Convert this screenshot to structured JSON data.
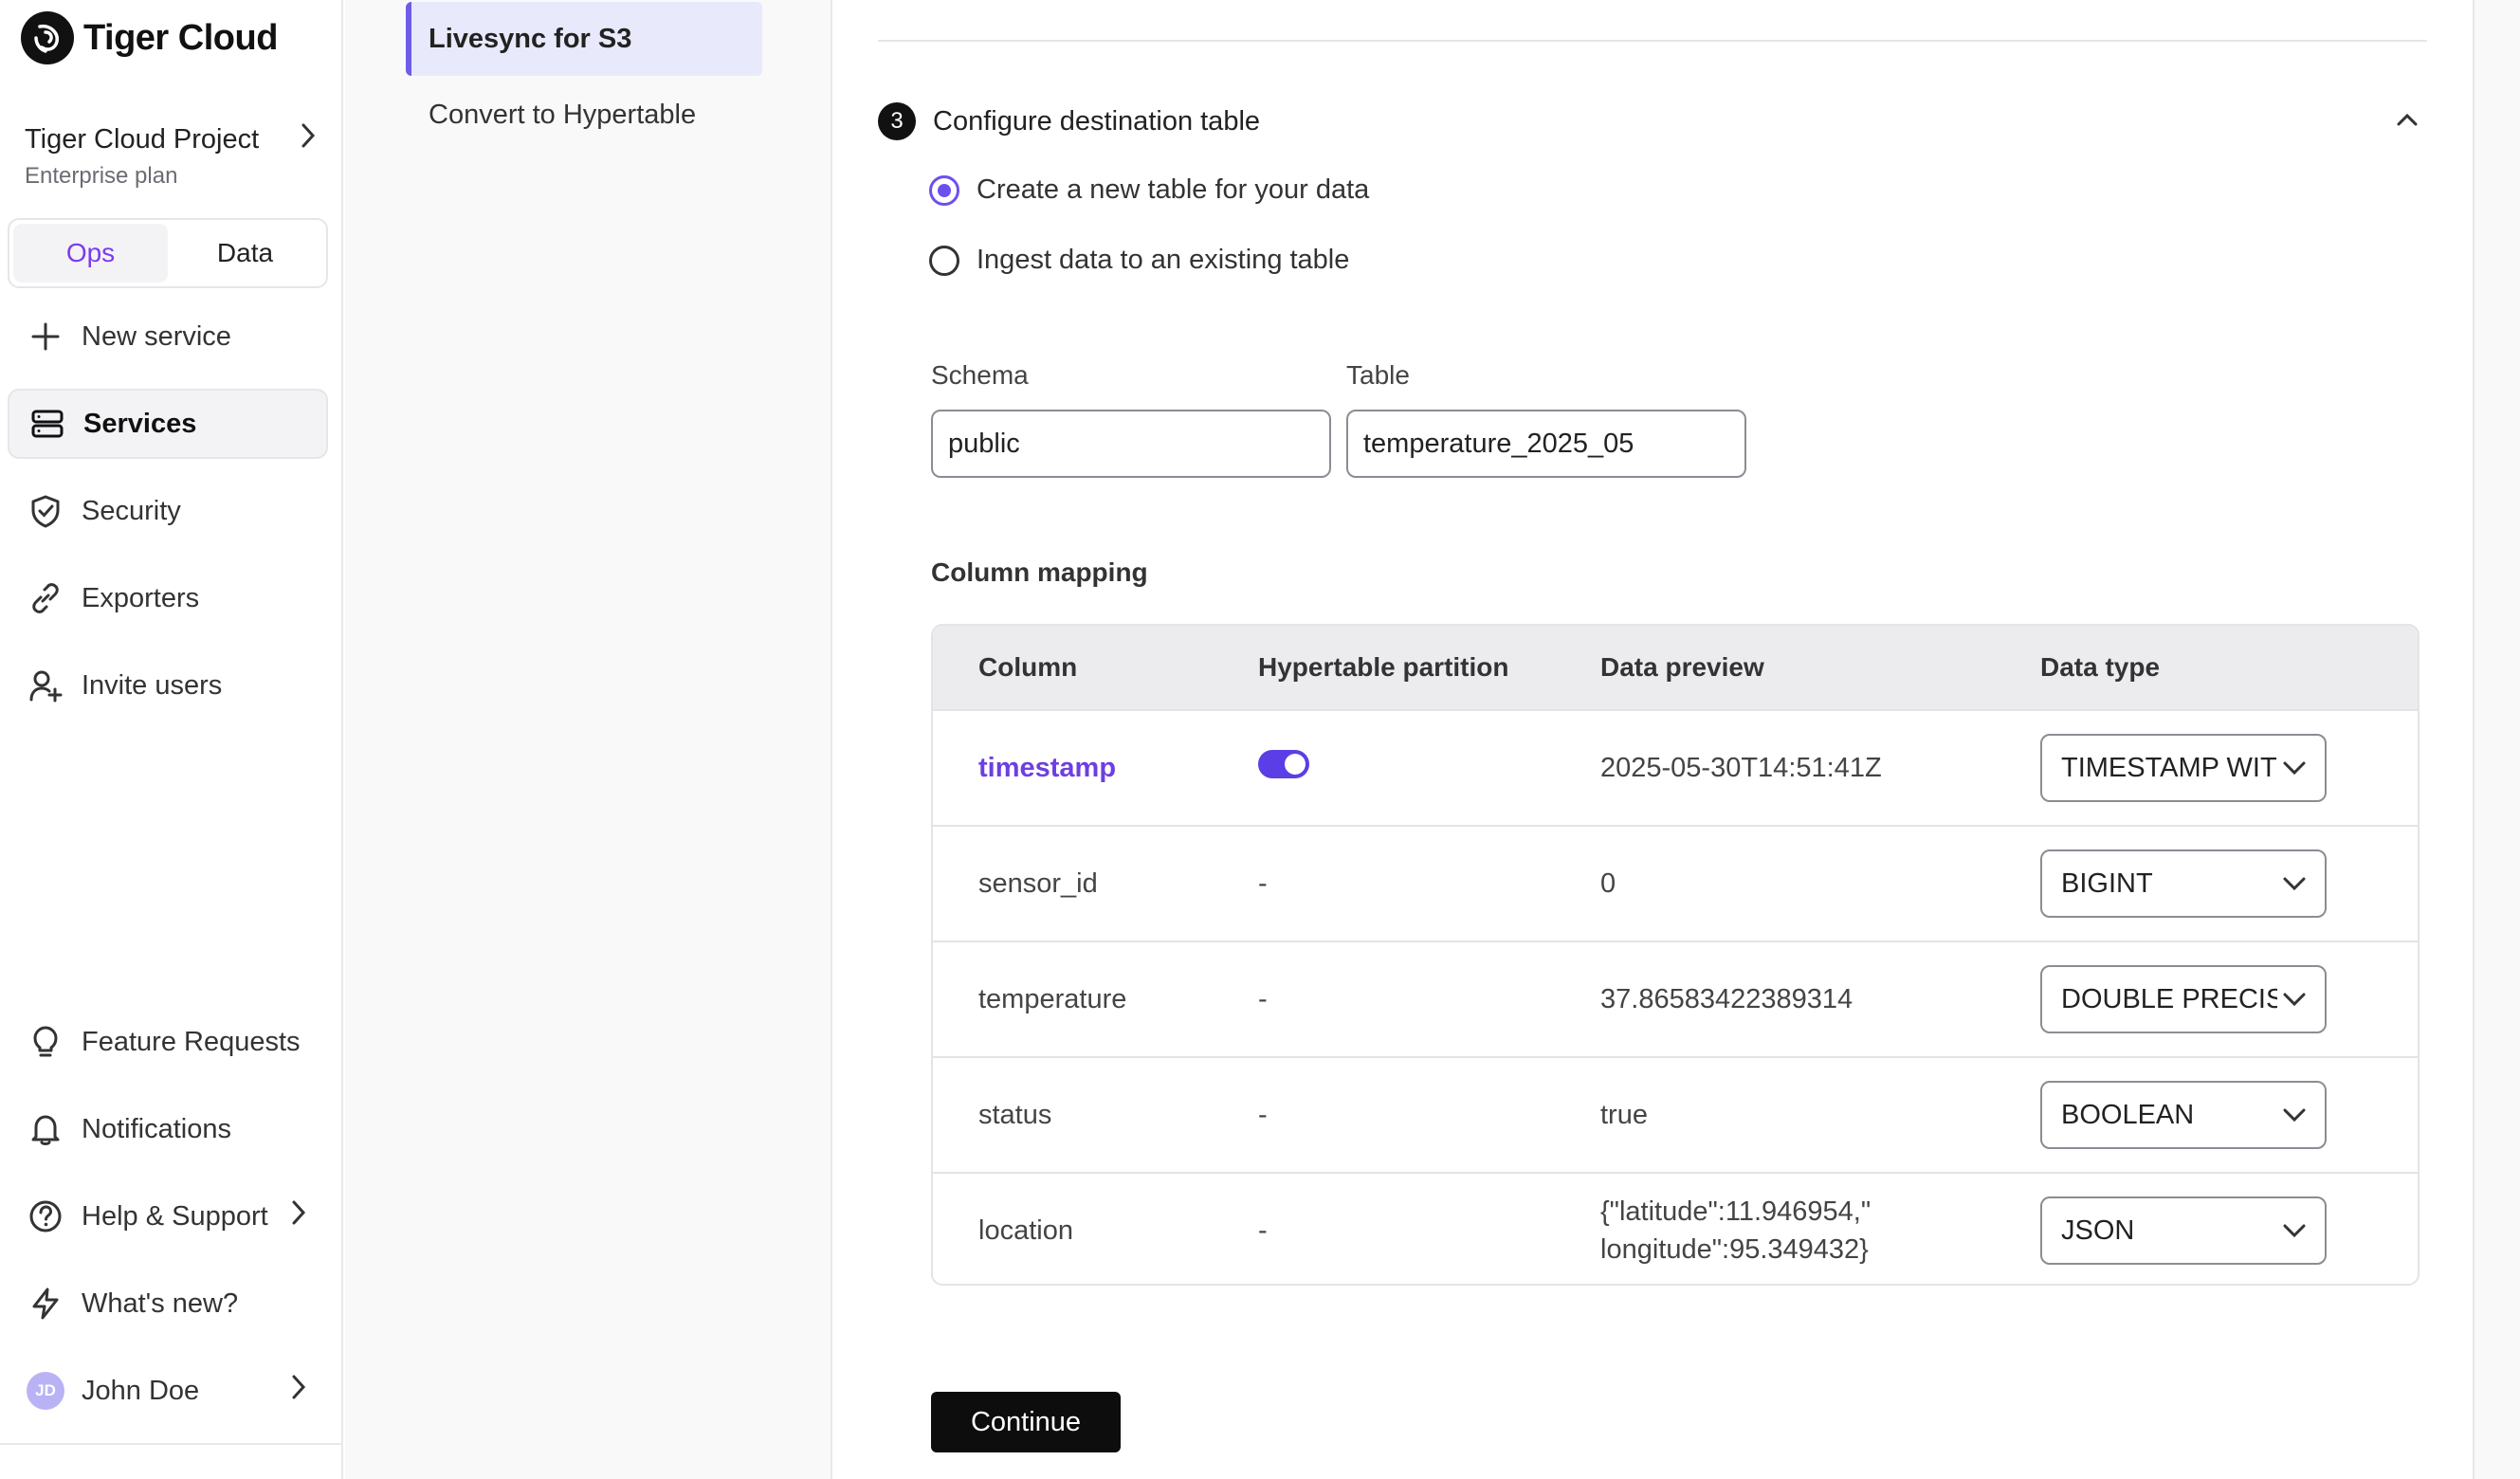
{
  "brand": {
    "name": "Tiger Cloud"
  },
  "project": {
    "name": "Tiger Cloud Project",
    "plan": "Enterprise plan"
  },
  "mode_switch": {
    "options": [
      "Ops",
      "Data"
    ],
    "active": "Ops"
  },
  "sidebar": {
    "items": [
      {
        "label": "New service",
        "icon": "plus-icon"
      },
      {
        "label": "Services",
        "icon": "services-icon",
        "active": true
      },
      {
        "label": "Security",
        "icon": "shield-check-icon"
      },
      {
        "label": "Exporters",
        "icon": "link-icon"
      },
      {
        "label": "Invite users",
        "icon": "user-plus-icon"
      }
    ],
    "bottom_items": [
      {
        "label": "Feature Requests",
        "icon": "lightbulb-icon"
      },
      {
        "label": "Notifications",
        "icon": "bell-icon"
      },
      {
        "label": "Help & Support",
        "icon": "help-circle-icon"
      },
      {
        "label": "What's new?",
        "icon": "lightning-icon"
      }
    ],
    "user": {
      "name": "John Doe",
      "initials": "JD"
    }
  },
  "subnav": {
    "items": [
      {
        "label": "Livesync for S3",
        "active": true
      },
      {
        "label": "Convert to Hypertable"
      }
    ]
  },
  "step": {
    "number": "3",
    "title": "Configure destination table",
    "options": [
      {
        "label": "Create a new table for your data",
        "checked": true
      },
      {
        "label": "Ingest data to an existing table",
        "checked": false
      }
    ],
    "schema_label": "Schema",
    "schema_value": "public",
    "table_label": "Table",
    "table_value": "temperature_2025_05",
    "mapping_title": "Column mapping",
    "columns": [
      "Column",
      "Hypertable partition",
      "Data preview",
      "Data type"
    ],
    "rows": [
      {
        "column": "timestamp",
        "partition": "toggle-on",
        "preview": "2025-05-30T14:51:41Z",
        "type": "TIMESTAMP WITH TIME ZONE"
      },
      {
        "column": "sensor_id",
        "partition": "-",
        "preview": "0",
        "type": "BIGINT"
      },
      {
        "column": "temperature",
        "partition": "-",
        "preview": "37.86583422389314",
        "type": "DOUBLE PRECISION"
      },
      {
        "column": "status",
        "partition": "-",
        "preview": "true",
        "type": "BOOLEAN"
      },
      {
        "column": "location",
        "partition": "-",
        "preview_line1": "{\"latitude\":11.946954,\"",
        "preview_line2": "longitude\":95.349432}",
        "type": "JSON"
      }
    ],
    "continue_label": "Continue"
  },
  "colors": {
    "accent": "#6d4ff0",
    "primary_button": "#0d0d0d",
    "active_tab_text": "#7c3aed"
  }
}
